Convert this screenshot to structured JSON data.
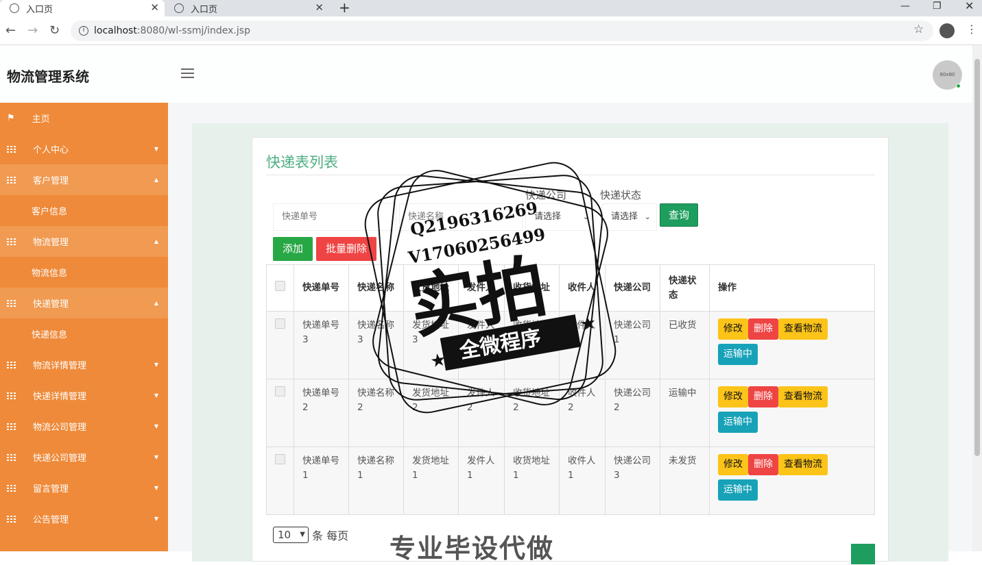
{
  "browser": {
    "tabs": [
      {
        "title": "入口页"
      },
      {
        "title": "入口页"
      }
    ],
    "url_host": "localhost",
    "url_rest": ":8080/wl-ssmj/index.jsp"
  },
  "header": {
    "brand": "物流管理系统",
    "avatar_text": "80x80"
  },
  "sidebar": {
    "items": [
      {
        "label": "主页"
      },
      {
        "label": "个人中心"
      },
      {
        "label": "客户管理"
      },
      {
        "label": "客户信息"
      },
      {
        "label": "物流管理"
      },
      {
        "label": "物流信息"
      },
      {
        "label": "快递管理"
      },
      {
        "label": "快递信息"
      },
      {
        "label": "物流详情管理"
      },
      {
        "label": "快递详情管理"
      },
      {
        "label": "物流公司管理"
      },
      {
        "label": "快递公司管理"
      },
      {
        "label": "留言管理"
      },
      {
        "label": "公告管理"
      }
    ]
  },
  "main": {
    "title": "快递表列表",
    "search": {
      "tracking_placeholder": "快递单号",
      "name_placeholder": "快递名称",
      "company_label": "快递公司",
      "company_value": "请选择",
      "status_label": "快递状态",
      "status_value": "请选择",
      "query_label": "查询"
    },
    "actions": {
      "add": "添加",
      "batch_delete": "批量删除"
    },
    "table": {
      "headers": [
        "快递单号",
        "快递名称",
        "发货地址",
        "发件人",
        "收货地址",
        "收件人",
        "快递公司",
        "快递状态",
        "操作"
      ],
      "rows": [
        [
          "快递单号3",
          "快递名称3",
          "发货地址3",
          "发件人3",
          "收货地址3",
          "收件人3",
          "快递公司1",
          "已收货"
        ],
        [
          "快递单号2",
          "快递名称2",
          "发货地址2",
          "发件人2",
          "收货地址2",
          "收件人2",
          "快递公司2",
          "运输中"
        ],
        [
          "快递单号1",
          "快递名称1",
          "发货地址1",
          "发件人1",
          "收货地址1",
          "收件人1",
          "快递公司3",
          "未发货"
        ]
      ],
      "op_buttons": {
        "edit": "修改",
        "delete": "删除",
        "view": "查看物流",
        "status": "运输中"
      }
    },
    "pager": {
      "page_size": "10",
      "suffix": "条 每页"
    }
  },
  "watermark": {
    "line1": "Q2196316269",
    "line2": "V17060256499",
    "big": "实拍",
    "banner": "全微程序",
    "bottom": "专业毕设代做"
  }
}
